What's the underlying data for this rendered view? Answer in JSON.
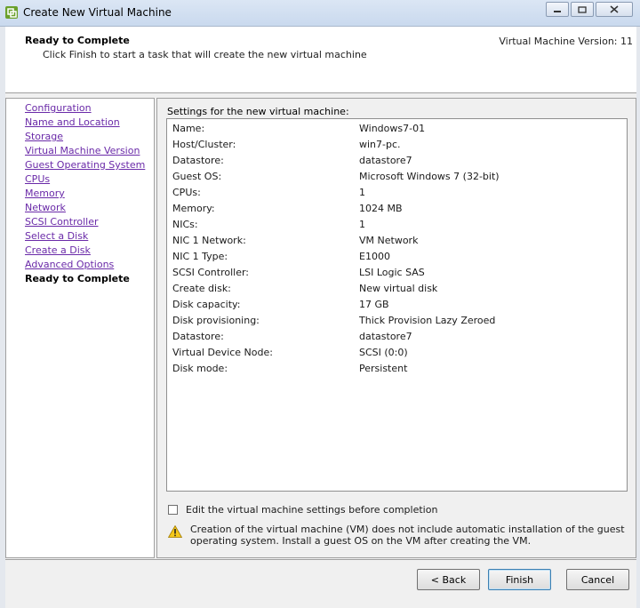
{
  "window": {
    "title": "Create New Virtual Machine"
  },
  "header": {
    "title": "Ready to Complete",
    "subtitle": "Click Finish to start a task that will create the new virtual machine",
    "version": "Virtual Machine Version: 11"
  },
  "sidebar": {
    "items": [
      {
        "label": "Configuration"
      },
      {
        "label": "Name and Location"
      },
      {
        "label": "Storage"
      },
      {
        "label": "Virtual Machine Version"
      },
      {
        "label": "Guest Operating System"
      },
      {
        "label": "CPUs"
      },
      {
        "label": "Memory"
      },
      {
        "label": "Network"
      },
      {
        "label": "SCSI Controller"
      },
      {
        "label": "Select a Disk"
      },
      {
        "label": "Create a Disk"
      },
      {
        "label": "Advanced Options"
      }
    ],
    "current": "Ready to Complete"
  },
  "settings": {
    "label": "Settings for the new virtual machine:",
    "rows": [
      {
        "key": "Name:",
        "value": "Windows7-01"
      },
      {
        "key": "Host/Cluster:",
        "value": "win7-pc."
      },
      {
        "key": "Datastore:",
        "value": "datastore7"
      },
      {
        "key": "Guest OS:",
        "value": "Microsoft Windows 7 (32-bit)"
      },
      {
        "key": "CPUs:",
        "value": "1"
      },
      {
        "key": "Memory:",
        "value": "1024 MB"
      },
      {
        "key": "NICs:",
        "value": "1"
      },
      {
        "key": "NIC 1 Network:",
        "value": "VM Network"
      },
      {
        "key": "NIC 1 Type:",
        "value": "E1000"
      },
      {
        "key": "SCSI Controller:",
        "value": "LSI Logic SAS"
      },
      {
        "key": "Create disk:",
        "value": "New virtual disk"
      },
      {
        "key": "Disk capacity:",
        "value": "17 GB"
      },
      {
        "key": "Disk provisioning:",
        "value": "Thick Provision Lazy Zeroed"
      },
      {
        "key": "Datastore:",
        "value": "datastore7"
      },
      {
        "key": "Virtual Device Node:",
        "value": "SCSI (0:0)"
      },
      {
        "key": "Disk mode:",
        "value": "Persistent"
      }
    ]
  },
  "options": {
    "edit_checkbox_label": "Edit the virtual machine settings before completion",
    "edit_checked": false
  },
  "warning": {
    "icon": "warning-icon",
    "text": "Creation of the virtual machine (VM) does not include automatic installation of the guest operating system. Install a guest OS on the VM after creating the VM."
  },
  "buttons": {
    "back": "< Back",
    "finish": "Finish",
    "cancel": "Cancel"
  },
  "colors": {
    "link": "#6a2aa8",
    "title_bar": "#c9d9ee",
    "panel_bg": "#f0f0f0"
  }
}
